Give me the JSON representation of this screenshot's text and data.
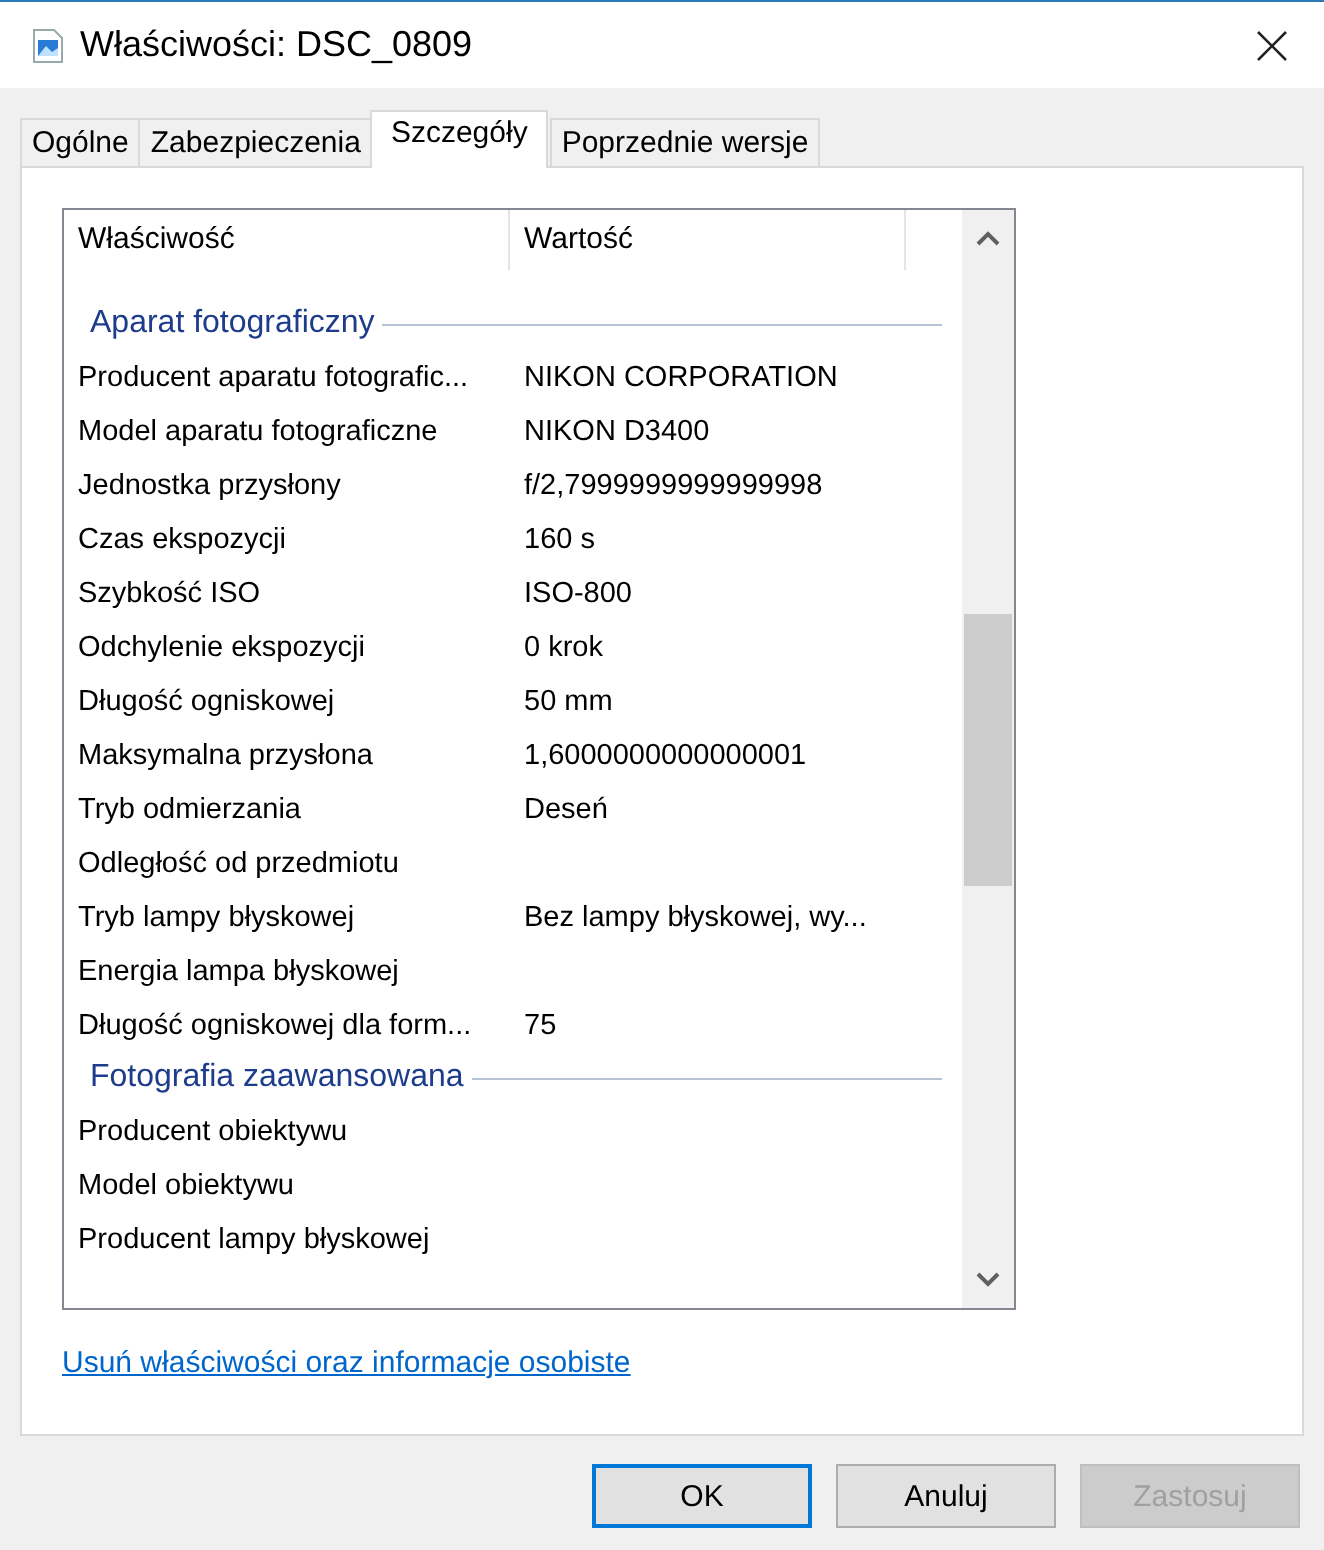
{
  "window": {
    "title": "Właściwości: DSC_0809"
  },
  "tabs": [
    {
      "label": "Ogólne",
      "selected": false
    },
    {
      "label": "Zabezpieczenia",
      "selected": false
    },
    {
      "label": "Szczegóły",
      "selected": true
    },
    {
      "label": "Poprzednie wersje",
      "selected": false
    }
  ],
  "table": {
    "columns": [
      "Właściwość",
      "Wartość"
    ],
    "groups": [
      {
        "title": "Aparat fotograficzny",
        "rows": [
          {
            "property": "Producent aparatu fotografic...",
            "value": "NIKON CORPORATION"
          },
          {
            "property": "Model aparatu fotograficzne",
            "value": "NIKON D3400"
          },
          {
            "property": "Jednostka przysłony",
            "value": "f/2,7999999999999998"
          },
          {
            "property": "Czas ekspozycji",
            "value": "160 s"
          },
          {
            "property": "Szybkość ISO",
            "value": "ISO-800"
          },
          {
            "property": "Odchylenie ekspozycji",
            "value": "0 krok"
          },
          {
            "property": "Długość ogniskowej",
            "value": "50 mm"
          },
          {
            "property": "Maksymalna przysłona",
            "value": "1,6000000000000001"
          },
          {
            "property": "Tryb odmierzania",
            "value": "Deseń"
          },
          {
            "property": "Odległość od przedmiotu"
          },
          {
            "property": "Tryb lampy błyskowej",
            "value": "Bez lampy błyskowej, wy..."
          },
          {
            "property": "Energia lampa błyskowej"
          },
          {
            "property": "Długość ogniskowej dla form...",
            "value": "75"
          }
        ]
      },
      {
        "title": "Fotografia zaawansowana",
        "rows": [
          {
            "property": "Producent obiektywu"
          },
          {
            "property": "Model obiektywu"
          },
          {
            "property": "Producent lampy błyskowej"
          }
        ]
      }
    ]
  },
  "link": "Usuń właściwości oraz informacje osobiste",
  "buttons": [
    {
      "label": "OK",
      "default": true,
      "disabled": false
    },
    {
      "label": "Anuluj",
      "default": false,
      "disabled": false
    },
    {
      "label": "Zastosuj",
      "default": false,
      "disabled": true
    }
  ]
}
